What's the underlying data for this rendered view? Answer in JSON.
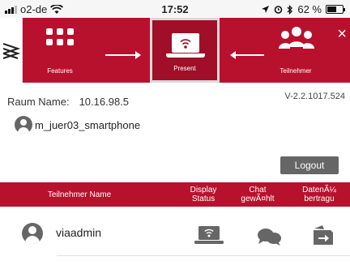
{
  "status_bar": {
    "carrier": "o2-de",
    "time": "17:52",
    "battery": "62 %",
    "battery_level": 0.62
  },
  "toolbar": {
    "features_label": "Features",
    "present_label": "Present",
    "participants_label": "Teilnehmer",
    "close_icon": "×"
  },
  "info": {
    "room_label": "Raum Name:",
    "room_value": "10.16.98.5",
    "version": "V-2.2.1017.524",
    "user_name": "m_juer03_smartphone"
  },
  "logout_label": "Logout",
  "table": {
    "headers": {
      "name": "Teilnehmer Name",
      "display_line1": "Display",
      "display_line2": "Status",
      "chat_line1": "Chat",
      "chat_line2": "gewÃ¤hlt",
      "daten_line1": "DatenÃ¼",
      "daten_line2": "bertragu"
    },
    "rows": [
      {
        "name": "viaadmin"
      }
    ]
  },
  "colors": {
    "brand_red": "#b8112d",
    "icon_gray": "#666666"
  },
  "icons": {
    "features": "grid-icon",
    "present": "laptop-wifi-icon",
    "participants": "people-icon",
    "display": "laptop-wifi-icon",
    "chat": "chat-bubbles-icon",
    "transfer": "file-transfer-icon"
  }
}
